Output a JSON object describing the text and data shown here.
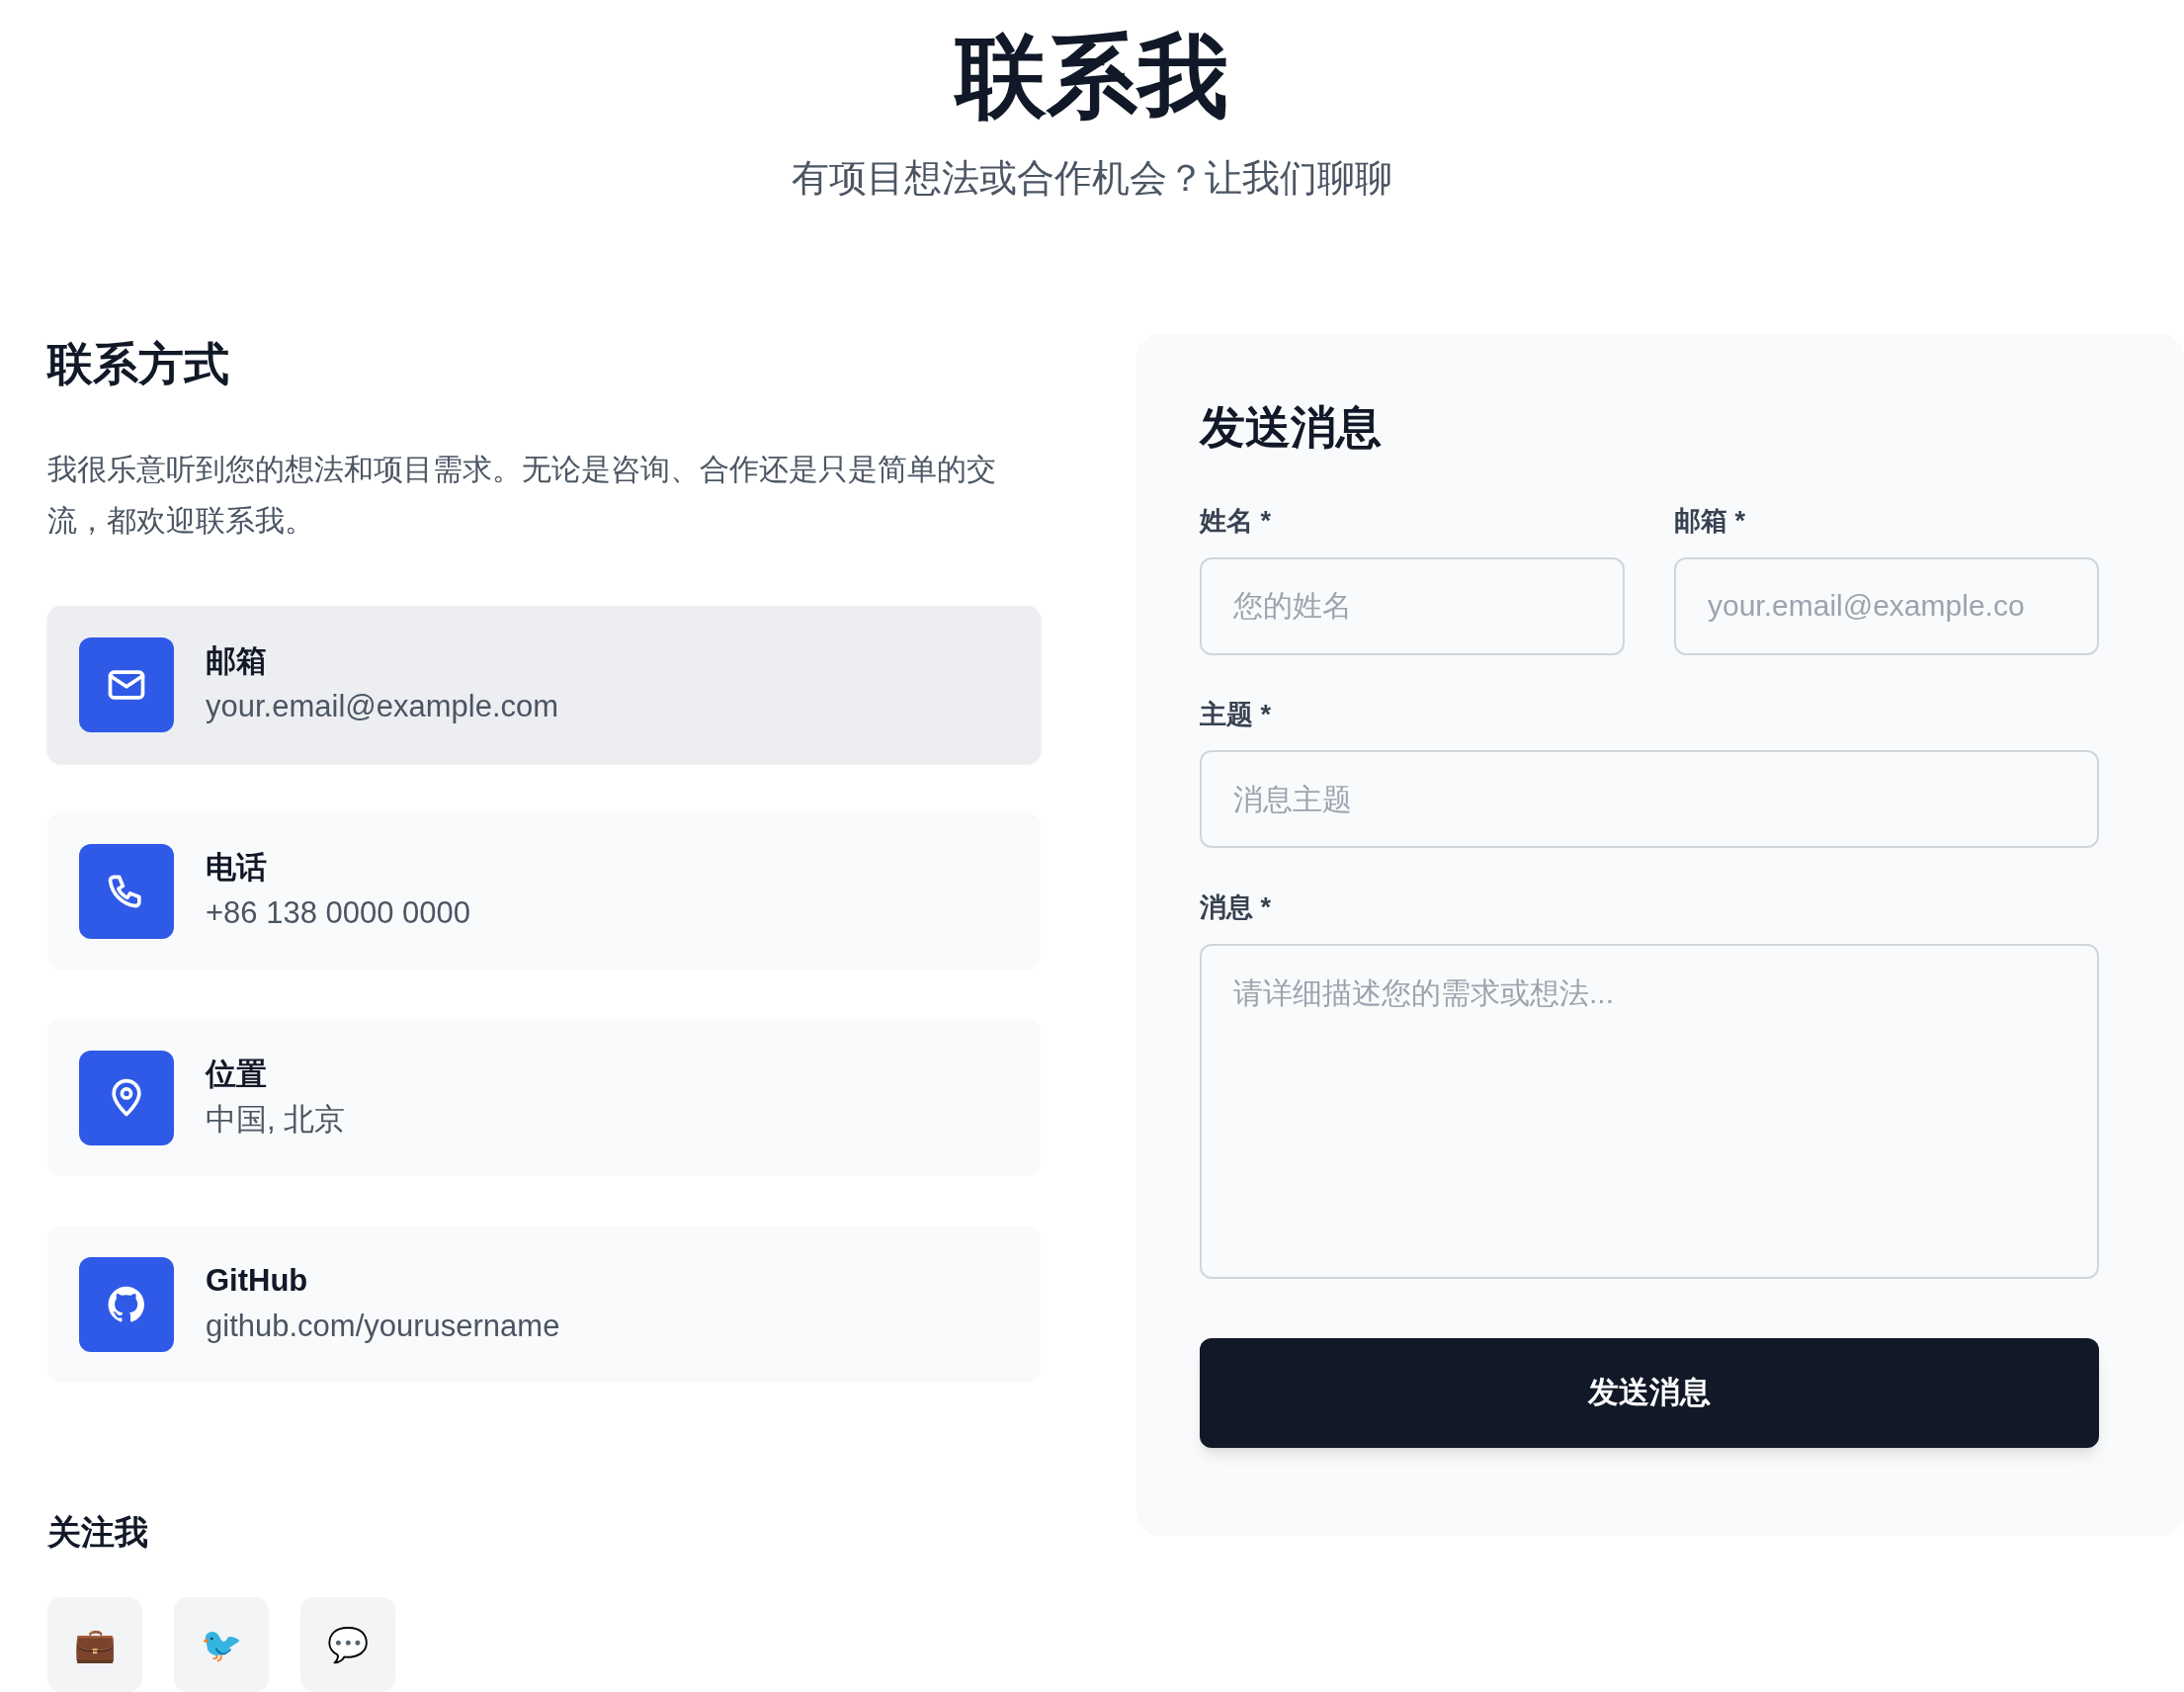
{
  "header": {
    "title": "联系我",
    "subtitle": "有项目想法或合作机会？让我们聊聊"
  },
  "contact": {
    "heading": "联系方式",
    "intro": "我很乐意听到您的想法和项目需求。无论是咨询、合作还是只是简单的交流，都欢迎联系我。",
    "items": [
      {
        "kind": "mail",
        "label": "邮箱",
        "value": "your.email@example.com",
        "hovered": true
      },
      {
        "kind": "phone",
        "label": "电话",
        "value": "+86 138 0000 0000",
        "hovered": false
      },
      {
        "kind": "location",
        "label": "位置",
        "value": "中国, 北京",
        "hovered": false
      },
      {
        "kind": "github",
        "label": "GitHub",
        "value": "github.com/yourusername",
        "hovered": false
      }
    ]
  },
  "social": {
    "heading": "关注我",
    "buttons": [
      {
        "glyph": "💼"
      },
      {
        "glyph": "🐦"
      },
      {
        "glyph": "💬"
      }
    ]
  },
  "form": {
    "heading": "发送消息",
    "fields": [
      {
        "kind": "input",
        "label": "姓名 *",
        "placeholder": "您的姓名"
      },
      {
        "kind": "input",
        "label": "邮箱 *",
        "placeholder": "your.email@example.co"
      },
      {
        "kind": "input",
        "label": "主题 *",
        "placeholder": "消息主题"
      },
      {
        "kind": "textarea",
        "label": "消息 *",
        "placeholder": "请详细描述您的需求或想法..."
      }
    ],
    "submit": "发送消息"
  }
}
